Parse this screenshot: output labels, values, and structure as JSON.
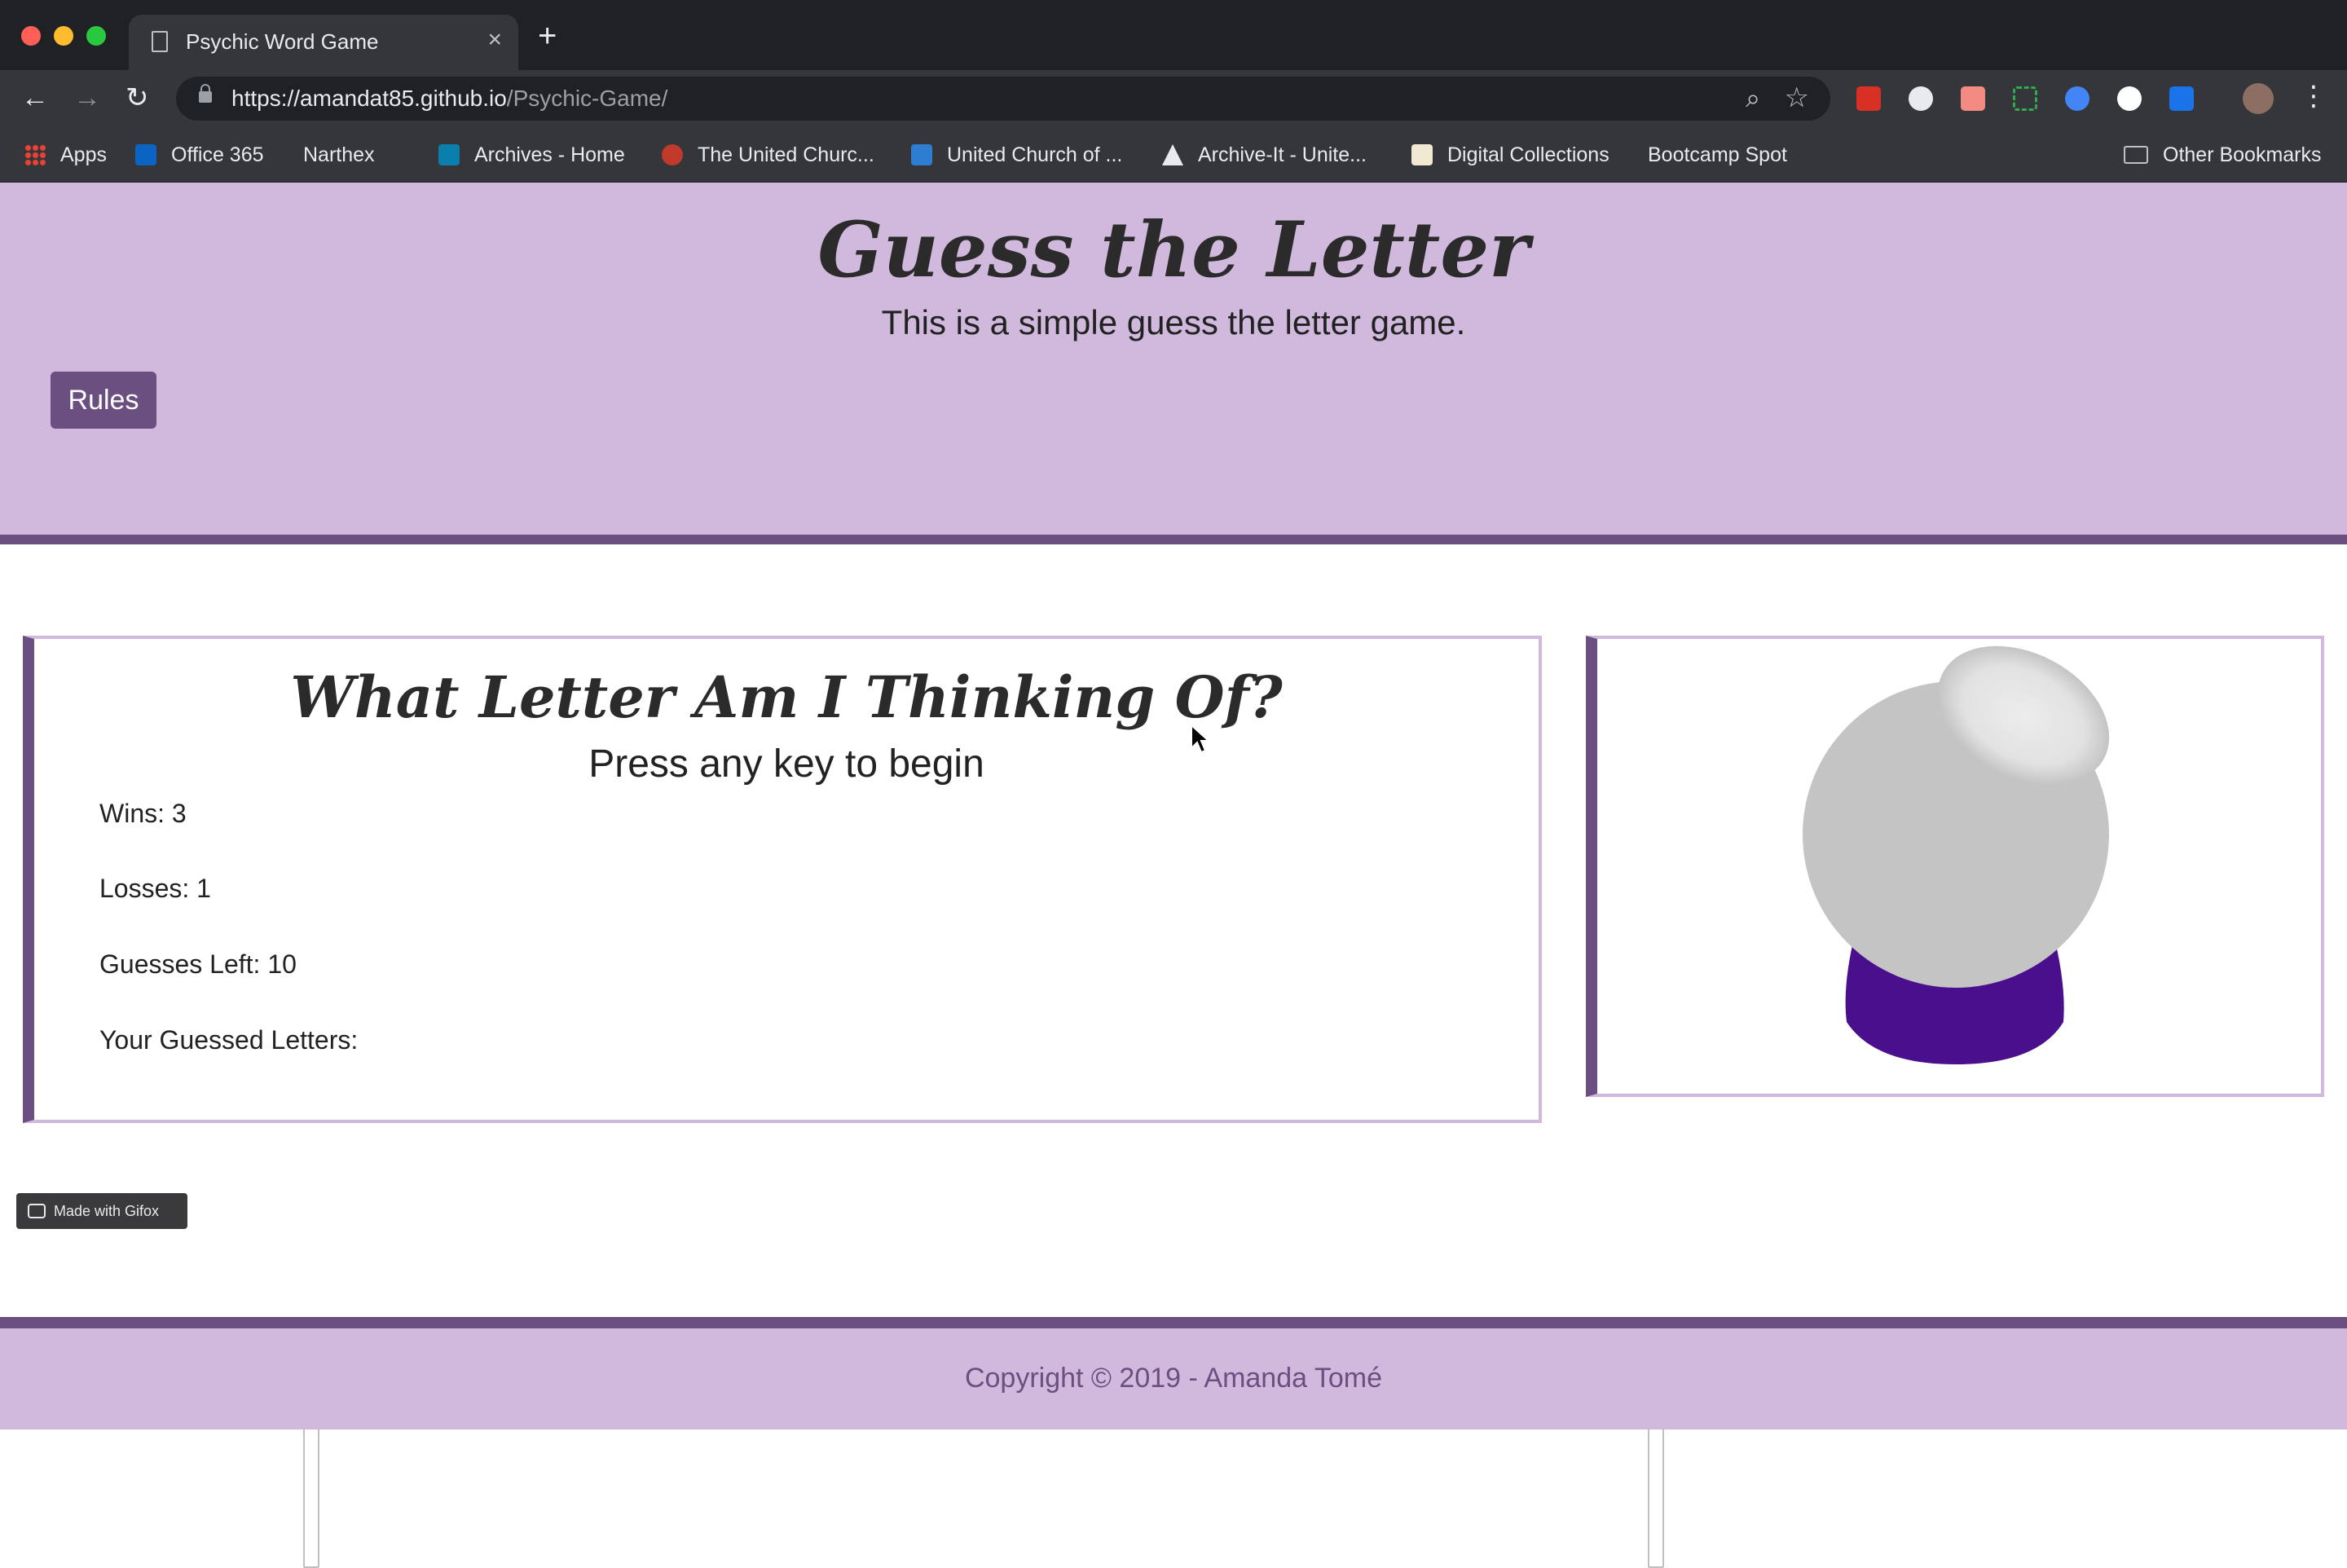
{
  "browser": {
    "tab_title": "Psychic Word Game",
    "tab_close": "×",
    "new_tab": "+",
    "back": "←",
    "forward": "→",
    "reload": "↻",
    "url_host": "https://amandat85.github.io",
    "url_path": "/Psychic-Game/",
    "zoom_icon": "⌕",
    "star_icon": "☆",
    "menu": "⋮"
  },
  "bookmarks": [
    {
      "label": "Apps",
      "icon": "apps-icon"
    },
    {
      "label": "Office 365",
      "icon": "outlook-icon"
    },
    {
      "label": "Narthex",
      "icon": "page-icon"
    },
    {
      "label": "Archives - Home",
      "icon": "sharepoint-icon"
    },
    {
      "label": "The United Churc...",
      "icon": "crest-icon"
    },
    {
      "label": "United Church of ...",
      "icon": "dove-icon"
    },
    {
      "label": "Archive-It - Unite...",
      "icon": "archive-it-icon"
    },
    {
      "label": "Digital Collections",
      "icon": "crest-icon"
    },
    {
      "label": "Bootcamp Spot",
      "icon": "page-icon"
    },
    {
      "label": "Other Bookmarks",
      "icon": "folder-icon"
    }
  ],
  "header": {
    "title": "Guess the Letter",
    "subtitle": "This is a simple guess the letter game.",
    "rules_label": "Rules"
  },
  "game": {
    "heading": "What Letter Am I Thinking Of?",
    "prompt": "Press any key to begin",
    "wins": "Wins: 3",
    "losses": "Losses: 1",
    "guesses_left": "Guesses Left: 10",
    "guessed_letters": "Your Guessed Letters:"
  },
  "footer": {
    "copyright": "Copyright © 2019 - Amanda Tomé"
  },
  "watermark": {
    "label": "Made with Gifox"
  },
  "colors": {
    "header_bg": "#d1b9de",
    "accent": "#6b4f80",
    "crystal_ball": "#c4c4c4",
    "crystal_base": "#4a0f8c"
  }
}
